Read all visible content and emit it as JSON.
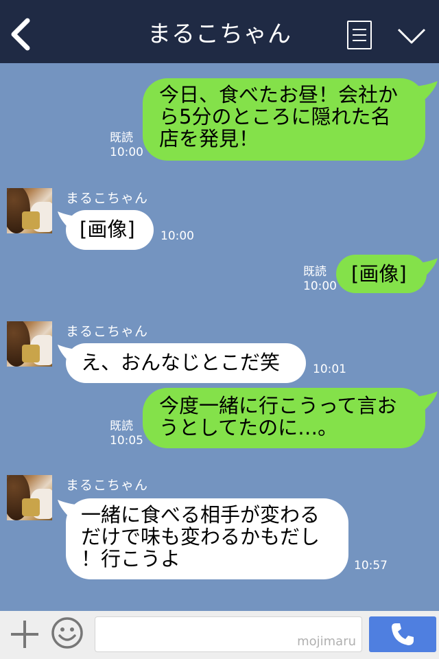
{
  "header": {
    "title": "まるこちゃん",
    "back_icon": "chevron-left-icon",
    "menu_icon": "list-icon",
    "expand_icon": "chevron-down-icon"
  },
  "messages": [
    {
      "from": "me",
      "text_lines": [
        "今日、食べたお昼！会社か",
        "ら5分のところに隠れた名",
        "店を発見！"
      ],
      "read": "既読",
      "time": "10:00"
    },
    {
      "from": "them",
      "name": "まるこちゃん",
      "text_lines": [
        "[画像]"
      ],
      "time": "10:00"
    },
    {
      "from": "me",
      "text_lines": [
        "[画像]"
      ],
      "read": "既読",
      "time": "10:00"
    },
    {
      "from": "them",
      "name": "まるこちゃん",
      "text_lines": [
        "え、おんなじとこだ笑"
      ],
      "time": "10:01"
    },
    {
      "from": "me",
      "text_lines": [
        "今度一緒に行こうって言お",
        "うとしてたのに…。"
      ],
      "read": "既読",
      "time": "10:05"
    },
    {
      "from": "them",
      "name": "まるこちゃん",
      "text_lines": [
        "一緒に食べる相手が変わる",
        "だけで味も変わるかもだし",
        "！行こうよ"
      ],
      "time": "10:57"
    }
  ],
  "input_bar": {
    "plus_icon": "plus-icon",
    "emoji_icon": "smile-icon",
    "placeholder": "",
    "watermark": "mojimaru",
    "call_icon": "phone-icon"
  },
  "colors": {
    "header_bg": "#1f2a44",
    "chat_bg": "#7494c0",
    "my_bubble": "#84e14a",
    "their_bubble": "#ffffff",
    "call_button": "#4f7fe0"
  }
}
